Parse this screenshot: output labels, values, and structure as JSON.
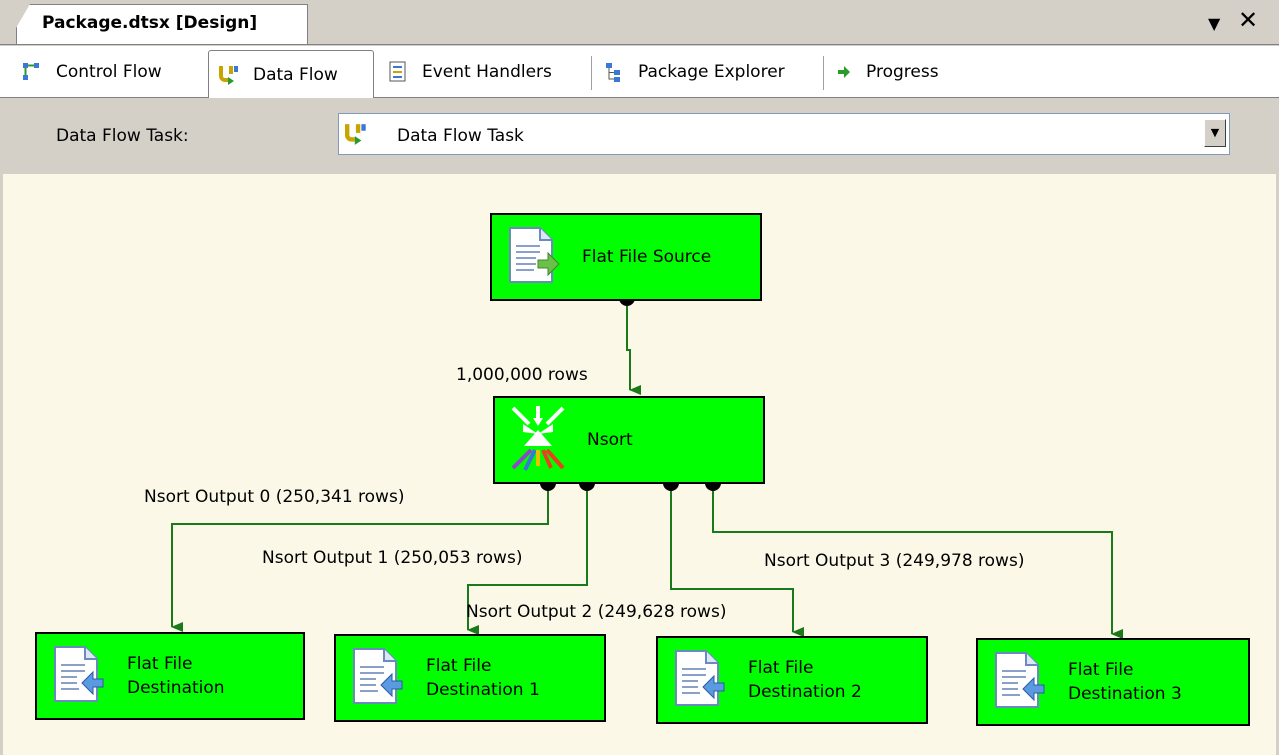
{
  "window": {
    "doc_tab": "Package.dtsx [Design]",
    "pin_icon": "dropdown-pin-icon",
    "close_icon": "close-icon"
  },
  "tabs": [
    {
      "label": "Control Flow",
      "icon": "control-flow-icon",
      "active": false
    },
    {
      "label": "Data Flow",
      "icon": "data-flow-icon",
      "active": true
    },
    {
      "label": "Event Handlers",
      "icon": "event-handlers-icon",
      "active": false
    },
    {
      "label": "Package Explorer",
      "icon": "package-explorer-icon",
      "active": false
    },
    {
      "label": "Progress",
      "icon": "progress-arrow-icon",
      "active": false
    }
  ],
  "task_bar": {
    "label": "Data Flow Task:",
    "selected": "Data Flow Task"
  },
  "components": {
    "source": "Flat File Source",
    "nsort": "Nsort",
    "dest0_line1": "Flat File",
    "dest0_line2": "Destination",
    "dest1_line1": "Flat File",
    "dest1_line2": "Destination 1",
    "dest2_line1": "Flat File",
    "dest2_line2": "Destination 2",
    "dest3_line1": "Flat File",
    "dest3_line2": "Destination 3"
  },
  "paths": {
    "source_to_nsort": "1,000,000 rows",
    "output0": "Nsort Output 0 (250,341 rows)",
    "output1": "Nsort Output 1 (250,053 rows)",
    "output2": "Nsort Output 2 (249,628 rows)",
    "output3": "Nsort Output 3 (249,978 rows)"
  },
  "colors": {
    "component_fill": "#00ff00",
    "path_color": "#1a7a1a",
    "canvas": "#fbf8e8"
  }
}
